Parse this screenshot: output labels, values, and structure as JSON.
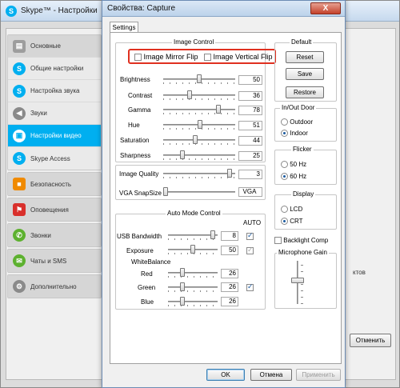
{
  "skype": {
    "title": "Skype™ - Настройки",
    "sidebar": [
      {
        "label": "Основные",
        "icon": "skype-general-icon",
        "top": true
      },
      {
        "label": "Общие настройки",
        "icon": "skype-logo-icon"
      },
      {
        "label": "Настройка звука",
        "icon": "skype-logo-icon"
      },
      {
        "label": "Звуки",
        "icon": "speaker-icon"
      },
      {
        "label": "Настройки видео",
        "icon": "video-icon",
        "active": true
      },
      {
        "label": "Skype Access",
        "icon": "skype-logo-icon"
      },
      {
        "label": "Безопасность",
        "icon": "lock-icon"
      },
      {
        "label": "Оповещения",
        "icon": "flag-icon"
      },
      {
        "label": "Звонки",
        "icon": "phone-icon"
      },
      {
        "label": "Чаты и SMS",
        "icon": "chat-icon"
      },
      {
        "label": "Дополнительно",
        "icon": "gear-icon"
      }
    ],
    "right_text": "ктов",
    "cancel_label": "Отменить"
  },
  "dialog": {
    "title": "Свойства: Capture",
    "close_label": "X",
    "tab_label": "Settings",
    "image_control": {
      "title": "Image Control",
      "mirror_flip": "Image Mirror Flip",
      "vertical_flip": "Image Vertical Flip",
      "rows": [
        {
          "label": "Brightness",
          "value": "50",
          "fraction": 0.5
        },
        {
          "label": "Contrast",
          "value": "36",
          "fraction": 0.36
        },
        {
          "label": "Gamma",
          "value": "78",
          "fraction": 0.78
        },
        {
          "label": "Hue",
          "value": "51",
          "fraction": 0.51
        },
        {
          "label": "Saturation",
          "value": "44",
          "fraction": 0.44
        },
        {
          "label": "Sharpness",
          "value": "25",
          "fraction": 0.25
        }
      ]
    },
    "image_quality": {
      "label": "Image Quality",
      "value": "3",
      "fraction": 0.95
    },
    "vga_snapsize": {
      "label": "VGA SnapSize",
      "value": "VGA",
      "fraction": 0.0
    },
    "auto_mode": {
      "title": "Auto Mode Control",
      "auto_label": "AUTO",
      "usb_bandwidth": {
        "label": "USB Bandwidth",
        "value": "8",
        "fraction": 0.95,
        "auto": true
      },
      "exposure": {
        "label": "Exposure",
        "value": "50",
        "fraction": 0.5,
        "auto": true,
        "auto_dim": true
      },
      "white_balance": "WhiteBalance",
      "red": {
        "label": "Red",
        "value": "26",
        "fraction": 0.26
      },
      "green": {
        "label": "Green",
        "value": "26",
        "fraction": 0.26,
        "auto": true
      },
      "blue": {
        "label": "Blue",
        "value": "26",
        "fraction": 0.26
      }
    },
    "default_group": {
      "title": "Default",
      "reset": "Reset",
      "save": "Save",
      "restore": "Restore"
    },
    "inout_door": {
      "title": "In/Out Door",
      "outdoor": "Outdoor",
      "indoor": "Indoor",
      "selected": "Indoor"
    },
    "flicker": {
      "title": "Flicker",
      "hz50": "50 Hz",
      "hz60": "60 Hz",
      "selected": "60 Hz"
    },
    "display": {
      "title": "Display",
      "lcd": "LCD",
      "crt": "CRT",
      "selected": "CRT"
    },
    "backlight_comp": "Backlight Comp",
    "mic_gain": {
      "title": "Microphone Gain",
      "fraction": 0.55
    },
    "buttons": {
      "ok": "OK",
      "cancel": "Отмена",
      "apply": "Применить"
    }
  }
}
